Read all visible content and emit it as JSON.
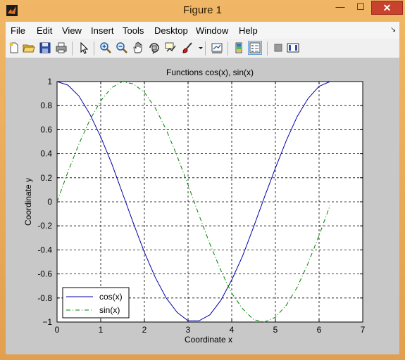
{
  "window": {
    "title": "Figure 1",
    "minimize_glyph": "—",
    "maximize_glyph": "☐",
    "close_glyph": "✕"
  },
  "menu": [
    "File",
    "Edit",
    "View",
    "Insert",
    "Tools",
    "Desktop",
    "Window",
    "Help"
  ],
  "toolbar_icons": [
    "new-figure-icon",
    "open-file-icon",
    "save-figure-icon",
    "print-figure-icon",
    "edit-plot-icon",
    "zoom-in-icon",
    "zoom-out-icon",
    "pan-icon",
    "rotate-3d-icon",
    "data-cursor-icon",
    "brush-icon",
    "link-plot-icon",
    "insert-colorbar-icon",
    "insert-legend-icon",
    "hide-plot-tools-icon",
    "show-plot-tools-icon"
  ],
  "chart_data": {
    "type": "line",
    "title": "Functions cos(x), sin(x)",
    "xlabel": "Coordinate x",
    "ylabel": "Coordinate y",
    "xlim": [
      0,
      7
    ],
    "ylim": [
      -1,
      1
    ],
    "xticks": [
      0,
      1,
      2,
      3,
      4,
      5,
      6,
      7
    ],
    "yticks": [
      1,
      0.8,
      0.6,
      0.4,
      0.2,
      0,
      -0.2,
      -0.4,
      -0.6,
      -0.8,
      -1
    ],
    "ytick_labels": [
      "1",
      "0.8",
      "0.6",
      "0.4",
      "0.2",
      "0",
      "-0.2",
      "-0.4",
      "-0.6",
      "-0.8",
      "−1"
    ],
    "xtick_labels": [
      "0",
      "1",
      "2",
      "3",
      "4",
      "5",
      "6",
      "7"
    ],
    "grid": true,
    "legend_position": "bottom-left",
    "series": [
      {
        "name": "cos(x)",
        "color": "#0000aa",
        "linestyle": "solid",
        "x": [
          0,
          0.25,
          0.5,
          0.75,
          1.0,
          1.25,
          1.5,
          1.75,
          2.0,
          2.25,
          2.5,
          2.75,
          3.0,
          3.25,
          3.5,
          3.75,
          4.0,
          4.25,
          4.5,
          4.75,
          5.0,
          5.25,
          5.5,
          5.75,
          6.0,
          6.25
        ],
        "y": [
          1.0,
          0.97,
          0.88,
          0.73,
          0.54,
          0.32,
          0.07,
          -0.18,
          -0.42,
          -0.63,
          -0.8,
          -0.92,
          -0.99,
          -0.99,
          -0.94,
          -0.82,
          -0.65,
          -0.45,
          -0.21,
          0.04,
          0.28,
          0.51,
          0.71,
          0.86,
          0.96,
          1.0
        ]
      },
      {
        "name": "sin(x)",
        "color": "#008000",
        "linestyle": "dashdot",
        "x": [
          0,
          0.25,
          0.5,
          0.75,
          1.0,
          1.25,
          1.5,
          1.75,
          2.0,
          2.25,
          2.5,
          2.75,
          3.0,
          3.25,
          3.5,
          3.75,
          4.0,
          4.25,
          4.5,
          4.75,
          5.0,
          5.25,
          5.5,
          5.75,
          6.0,
          6.25
        ],
        "y": [
          0.0,
          0.25,
          0.48,
          0.68,
          0.84,
          0.95,
          1.0,
          0.98,
          0.91,
          0.78,
          0.6,
          0.38,
          0.14,
          -0.11,
          -0.35,
          -0.57,
          -0.76,
          -0.89,
          -0.98,
          -1.0,
          -0.96,
          -0.86,
          -0.71,
          -0.51,
          -0.28,
          -0.03
        ]
      }
    ]
  }
}
